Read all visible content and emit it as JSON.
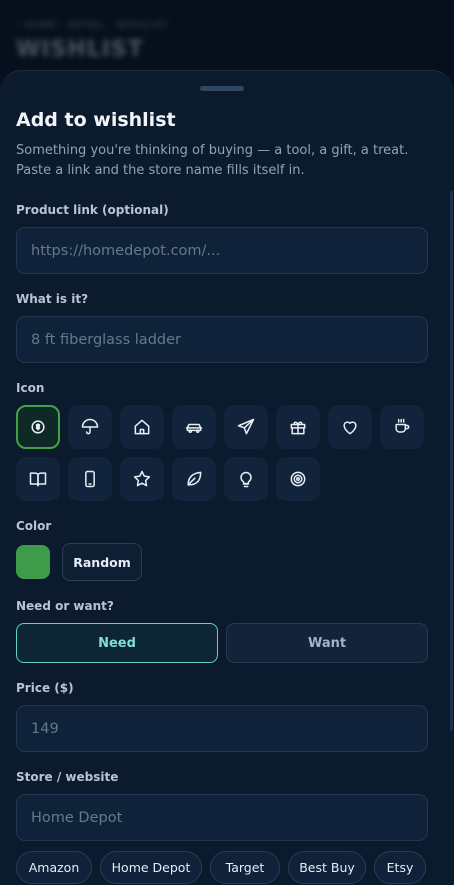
{
  "background": {
    "breadcrumb": "‹ HOME · DETAIL · WISHLIST",
    "title": "WISHLIST"
  },
  "sheet": {
    "title": "Add to wishlist",
    "subtitle": "Something you're thinking of buying — a tool, a gift, a treat. Paste a link and the store name fills itself in.",
    "product_link": {
      "label": "Product link (optional)",
      "placeholder": "https://homedepot.com/...",
      "value": ""
    },
    "what": {
      "label": "What is it?",
      "placeholder": "8 ft fiberglass ladder",
      "value": ""
    },
    "icon": {
      "label": "Icon",
      "selected": "coin-icon",
      "items": [
        "coin-icon",
        "umbrella-icon",
        "home-icon",
        "car-icon",
        "send-icon",
        "gift-icon",
        "heart-icon",
        "coffee-icon",
        "book-icon",
        "phone-icon",
        "star-icon",
        "leaf-icon",
        "lightbulb-icon",
        "target-icon"
      ]
    },
    "color": {
      "label": "Color",
      "value": "#3e9b49",
      "random_label": "Random"
    },
    "need_want": {
      "label": "Need or want?",
      "need": "Need",
      "want": "Want",
      "selected": "Need"
    },
    "price": {
      "label": "Price ($)",
      "placeholder": "149",
      "value": ""
    },
    "store": {
      "label": "Store / website",
      "placeholder": "Home Depot",
      "value": "",
      "suggestions": [
        "Amazon",
        "Home Depot",
        "Target",
        "Best Buy",
        "Etsy"
      ]
    }
  },
  "colors": {
    "accent_selected": "#5fd2c5",
    "icon_selected_border": "#3fa348",
    "sheet_bg": "#0b1a2c"
  }
}
